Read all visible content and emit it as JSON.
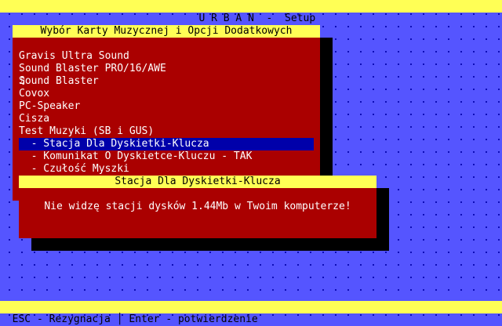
{
  "header": {
    "title": "U R B A N  -  Setup"
  },
  "menu": {
    "title": "Wybór Karty Muzycznej i Opcji Dodatkowych",
    "items": [
      {
        "label": "Gravis Ultra Sound"
      },
      {
        "label": "Sound Blaster PRO/16/AWE"
      },
      {
        "label": "Sound Blaster"
      },
      {
        "label": "Covox"
      },
      {
        "label": "PC-Speaker"
      },
      {
        "label": "Cisza"
      },
      {
        "label": "Test Muzyki (SB i GUS)"
      },
      {
        "label": "  - Stacja Dla Dyskietki-Klucza"
      },
      {
        "label": "  - Komunikat O Dyskietce-Kluczu - TAK"
      },
      {
        "label": "  - Czułość Myszki"
      }
    ],
    "current_icon": "music-note-icon",
    "current_icon_glyph": "♫"
  },
  "dialog": {
    "title": "Stacja Dla Dyskietki-Klucza",
    "message": "Nie widzę stacji dysków 1.44Mb w Twoim komputerze!"
  },
  "footer": {
    "text": "ESC - Rezygnacja │ Enter - potwierdzenie"
  },
  "colors": {
    "desktop": "#5555ff",
    "panel": "#aa0000",
    "bar": "#ffff55",
    "selection": "#0000aa",
    "shadow": "#000000"
  }
}
